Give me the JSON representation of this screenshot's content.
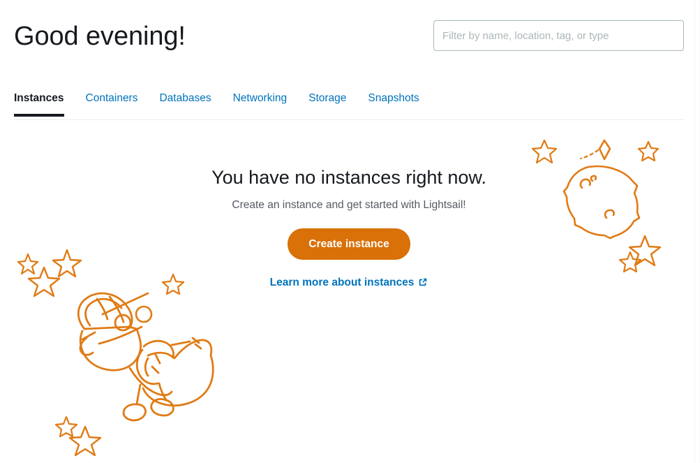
{
  "page": {
    "title": "Lightsail instances empty state"
  },
  "header": {
    "greeting": "Good evening!",
    "filter": {
      "placeholder": "Filter by name, location, tag, or type",
      "value": ""
    }
  },
  "tabs": [
    {
      "label": "Instances",
      "active": true
    },
    {
      "label": "Containers",
      "active": false
    },
    {
      "label": "Databases",
      "active": false
    },
    {
      "label": "Networking",
      "active": false
    },
    {
      "label": "Storage",
      "active": false
    },
    {
      "label": "Snapshots",
      "active": false
    }
  ],
  "empty_state": {
    "title": "You have no instances right now.",
    "subtitle": "Create an instance and get started with Lightsail!",
    "primary_button": "Create instance",
    "learn_more_link": "Learn more about instances",
    "external_icon": "external-link-icon"
  },
  "illustration": {
    "robot": "robot-astronaut-illustration",
    "planet": "planet-illustration",
    "comet": "comet-illustration",
    "stars": "star-decorations"
  },
  "colors": {
    "accent_orange": "#d97008",
    "link_blue": "#0073bb",
    "text_dark": "#16191f",
    "text_muted": "#545b64",
    "border_gray": "#aab7b8",
    "rule_gray": "#eaeded",
    "illustration_orange": "#e07b15"
  }
}
